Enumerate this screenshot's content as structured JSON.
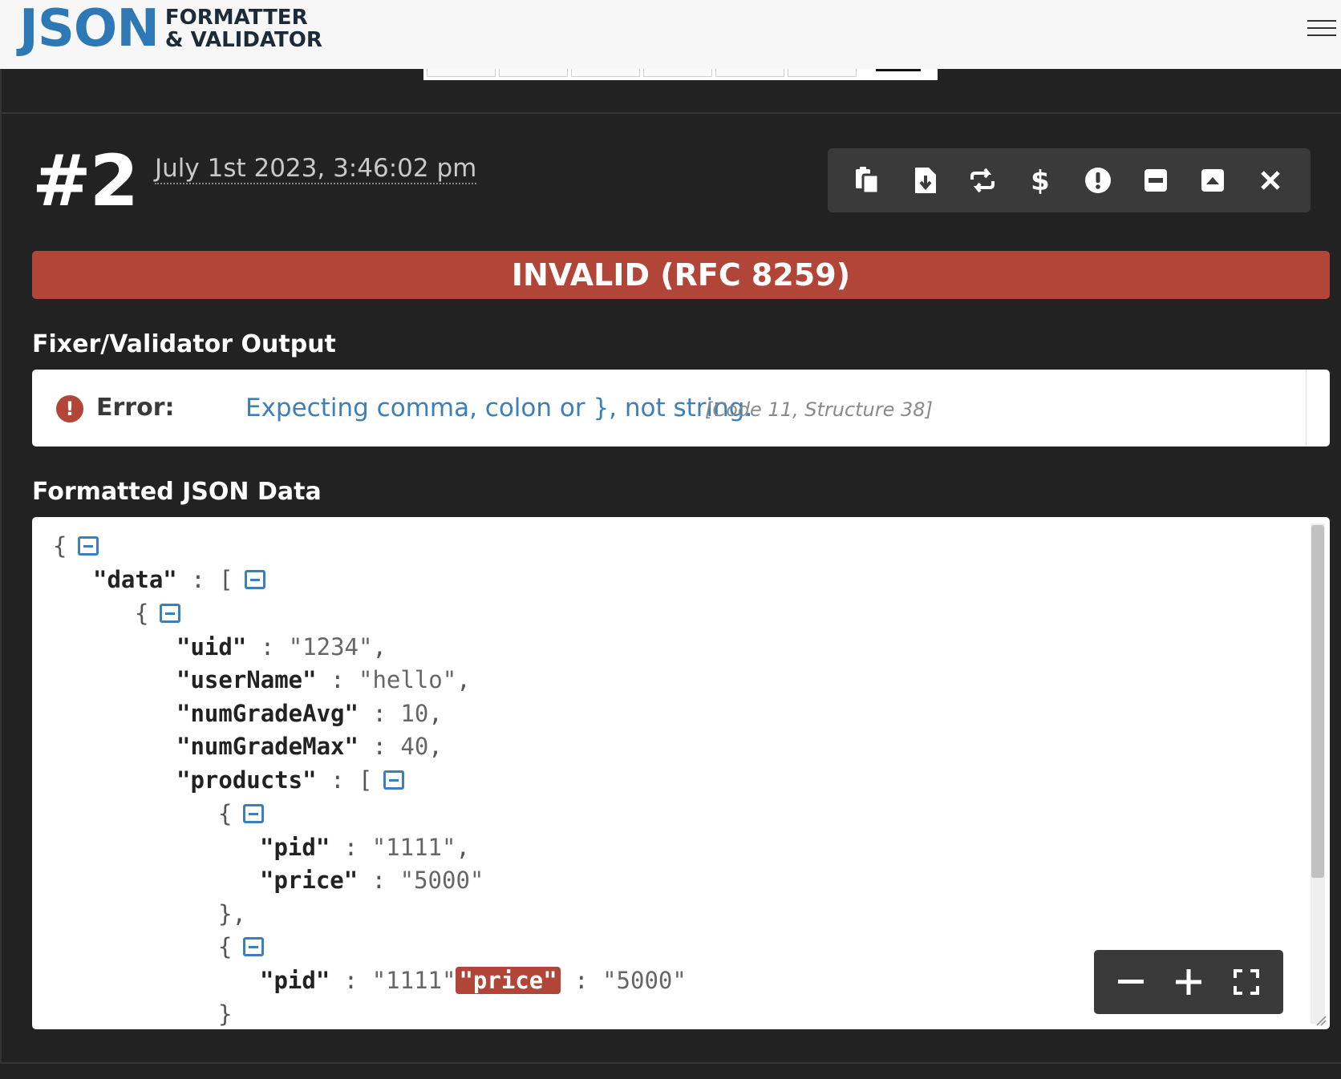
{
  "header": {
    "logo_big": "JSON",
    "logo_line1": "FORMATTER",
    "logo_line2": "& VALIDATOR"
  },
  "entry": {
    "number": "#2",
    "timestamp": "July 1st 2023, 3:46:02 pm"
  },
  "toolbar": {
    "icons": [
      "copy-icon",
      "download-icon",
      "repeat-icon",
      "dollar-icon",
      "exclamation-icon",
      "minus-square-icon",
      "caret-up-square-icon",
      "close-icon"
    ]
  },
  "status": {
    "text": "INVALID (RFC 8259)",
    "color": "#b04538"
  },
  "validator": {
    "section_title": "Fixer/Validator Output",
    "error_label": "Error:",
    "error_message": "Expecting comma, colon or }, not string.",
    "error_code": "[Code 11, Structure 38]"
  },
  "formatted": {
    "section_title": "Formatted JSON Data",
    "lines": {
      "l1_open": "{",
      "l2_key": "\"data\"",
      "l2_sep": " : [",
      "l3_open": "{",
      "l4_key": "\"uid\"",
      "l4_val": "\"1234\"",
      "l5_key": "\"userName\"",
      "l5_val": "\"hello\"",
      "l6_key": "\"numGradeAvg\"",
      "l6_val": "10",
      "l7_key": "\"numGradeMax\"",
      "l7_val": "40",
      "l8_key": "\"products\"",
      "l8_sep": " : [",
      "l9_open": "{",
      "l10_key": "\"pid\"",
      "l10_val": "\"1111\"",
      "l11_key": "\"price\"",
      "l11_val": "\"5000\"",
      "l12_close": "},",
      "l13_open": "{",
      "l14_key": "\"pid\"",
      "l14_val": "\"1111\"",
      "l14_err": "\"price\"",
      "l14_val2": "\"5000\"",
      "l15_close": "}"
    }
  },
  "zoom": {
    "icons": [
      "zoom-out-icon",
      "zoom-in-icon",
      "fullscreen-icon"
    ]
  },
  "colors": {
    "accent_blue": "#3d7fb8",
    "error_red": "#b04538",
    "background": "#222222"
  }
}
